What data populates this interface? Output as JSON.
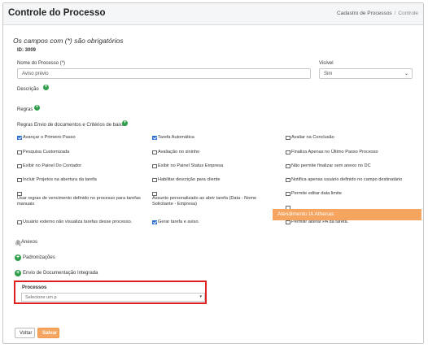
{
  "header": {
    "title": "Controle do Processo",
    "breadcrumb": [
      "Cadastro de Processos",
      "Controle"
    ]
  },
  "form": {
    "required_note": "Os campos com (*) são obrigatórios",
    "id_line": "ID: 3009",
    "name_label": "Nome do Processo (*)",
    "name_value": "Aviso prévio",
    "visible_label": "Visível",
    "visible_value": "Sim",
    "description_label": "Descrição",
    "rules_label": "Regras",
    "rules_docs_label": "Regras Envio de documentos e Critérios de baixa"
  },
  "checkboxes": [
    {
      "label": "Avançar o Primeiro Passo",
      "checked": true
    },
    {
      "label": "Tarefa Automática",
      "checked": true
    },
    {
      "label": "Avaliar na Conclusão",
      "checked": false
    },
    {
      "label": "Pesquisa Customizada",
      "checked": false
    },
    {
      "label": "Avaliação no sininho",
      "checked": false
    },
    {
      "label": "Finaliza Apenas no Último Passo Processo",
      "checked": false
    },
    {
      "label": "Exibir no Painel Do Contador",
      "checked": false
    },
    {
      "label": "Exibir no Painel Status Empresa",
      "checked": false
    },
    {
      "label": "Não permite finalizar sem anexo no DC",
      "checked": false
    },
    {
      "label": "Incluir Projetos na abertura da tarefa",
      "checked": false
    },
    {
      "label": "Habilitar descrição para cliente",
      "checked": false
    },
    {
      "label": "Notifica apenas usuário definido no campo destinatário",
      "checked": false
    },
    {
      "label": "Usar regras de vencimento definido no processo para tarefas manuais",
      "checked": false
    },
    {
      "label": "Assunto personalizado ao abrir tarefa (Data - Nome Solicitante - Empresa)",
      "checked": false
    },
    {
      "label": "Permite editar data limite",
      "checked": false
    },
    {
      "label": "Usuário externo não visualiza tarefas desse processo.",
      "checked": false
    },
    {
      "label": "Gerar tarefa e aviso.",
      "checked": true
    },
    {
      "label": "Permitir alterar PA da tarefa.",
      "checked": false
    }
  ],
  "ia_banner": "Atendimento IA Athenas",
  "sections": {
    "anexos": "Anexos",
    "padronizacoes": "Padronizações",
    "envio_doc": "Envio de Documentação Integrada"
  },
  "processos": {
    "label": "Processos",
    "placeholder": "Selecione um p"
  },
  "buttons": {
    "back": "Voltar",
    "save": "Salvar"
  },
  "colors": {
    "accent": "#f5a55f",
    "plus": "#2e9e4a",
    "highlight": "#e02020",
    "checkbox_checked": "#2b6fd6"
  }
}
